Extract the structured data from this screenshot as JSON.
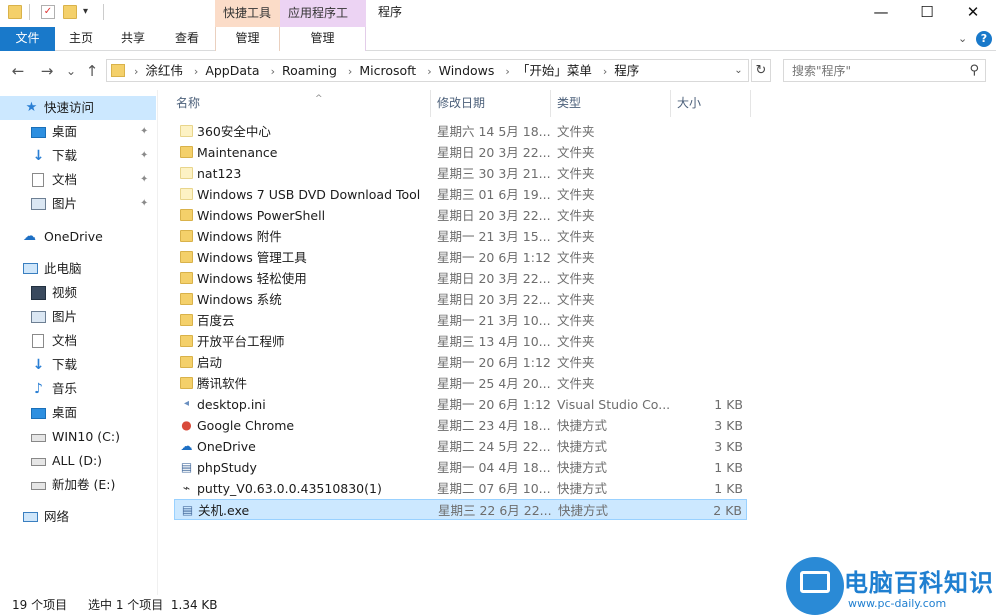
{
  "titlebar": {
    "context_tab_quick": "快捷工具",
    "context_tab_app": "应用程序工具",
    "window_title": "程序",
    "minimize_glyph": "—",
    "maximize_glyph": "☐",
    "close_glyph": "✕"
  },
  "ribbon": {
    "tabs": {
      "file": "文件",
      "home": "主页",
      "share": "共享",
      "view": "查看",
      "manage1": "管理",
      "manage2": "管理"
    }
  },
  "nav": {
    "back_glyph": "←",
    "forward_glyph": "→",
    "recent_glyph": "⌄",
    "up_glyph": "↑",
    "breadcrumbs": [
      "涂红伟",
      "AppData",
      "Roaming",
      "Microsoft",
      "Windows",
      "「开始」菜单",
      "程序"
    ],
    "refresh_glyph": "↻",
    "search_placeholder": "搜索\"程序\""
  },
  "sidebar": {
    "quick_access": "快速访问",
    "quick_items": [
      "桌面",
      "下载",
      "文档",
      "图片"
    ],
    "onedrive": "OneDrive",
    "this_pc": "此电脑",
    "pc_items": [
      "视频",
      "图片",
      "文档",
      "下载",
      "音乐",
      "桌面",
      "WIN10 (C:)",
      "ALL (D:)",
      "新加卷 (E:)"
    ],
    "network": "网络"
  },
  "columns": {
    "name": "名称",
    "date": "修改日期",
    "type": "类型",
    "size": "大小"
  },
  "files": [
    {
      "name": "360安全中心",
      "date": "星期六 14 5月 18...",
      "type": "文件夹",
      "size": "",
      "icon": "folder-pale-icon"
    },
    {
      "name": "Maintenance",
      "date": "星期日 20 3月 22...",
      "type": "文件夹",
      "size": "",
      "icon": "folder-icon"
    },
    {
      "name": "nat123",
      "date": "星期三 30 3月 21...",
      "type": "文件夹",
      "size": "",
      "icon": "folder-pale-icon"
    },
    {
      "name": "Windows 7 USB DVD Download Tool",
      "date": "星期三 01 6月 19...",
      "type": "文件夹",
      "size": "",
      "icon": "folder-pale-icon"
    },
    {
      "name": "Windows PowerShell",
      "date": "星期日 20 3月 22...",
      "type": "文件夹",
      "size": "",
      "icon": "folder-icon"
    },
    {
      "name": "Windows 附件",
      "date": "星期一 21 3月 15...",
      "type": "文件夹",
      "size": "",
      "icon": "folder-icon"
    },
    {
      "name": "Windows 管理工具",
      "date": "星期一 20 6月 1:12",
      "type": "文件夹",
      "size": "",
      "icon": "folder-icon"
    },
    {
      "name": "Windows 轻松使用",
      "date": "星期日 20 3月 22...",
      "type": "文件夹",
      "size": "",
      "icon": "folder-icon"
    },
    {
      "name": "Windows 系统",
      "date": "星期日 20 3月 22...",
      "type": "文件夹",
      "size": "",
      "icon": "folder-icon"
    },
    {
      "name": "百度云",
      "date": "星期一 21 3月 10...",
      "type": "文件夹",
      "size": "",
      "icon": "folder-icon"
    },
    {
      "name": "开放平台工程师",
      "date": "星期三 13 4月 10...",
      "type": "文件夹",
      "size": "",
      "icon": "folder-icon"
    },
    {
      "name": "启动",
      "date": "星期一 20 6月 1:12",
      "type": "文件夹",
      "size": "",
      "icon": "folder-icon"
    },
    {
      "name": "腾讯软件",
      "date": "星期一 25 4月 20...",
      "type": "文件夹",
      "size": "",
      "icon": "folder-icon"
    },
    {
      "name": "desktop.ini",
      "date": "星期一 20 6月 1:12",
      "type": "Visual Studio Co...",
      "size": "1 KB",
      "icon": "ini-file-icon"
    },
    {
      "name": "Google Chrome",
      "date": "星期二 23 4月 18...",
      "type": "快捷方式",
      "size": "3 KB",
      "icon": "chrome-icon"
    },
    {
      "name": "OneDrive",
      "date": "星期二 24 5月 22...",
      "type": "快捷方式",
      "size": "3 KB",
      "icon": "onedrive-icon"
    },
    {
      "name": "phpStudy",
      "date": "星期一 04 4月 18...",
      "type": "快捷方式",
      "size": "1 KB",
      "icon": "shortcut-icon"
    },
    {
      "name": "putty_V0.63.0.0.43510830(1)",
      "date": "星期二 07 6月 10...",
      "type": "快捷方式",
      "size": "1 KB",
      "icon": "putty-icon"
    },
    {
      "name": "关机.exe",
      "date": "星期三 22 6月 22...",
      "type": "快捷方式",
      "size": "2 KB",
      "icon": "shortcut-icon"
    }
  ],
  "status": {
    "count": "19 个项目",
    "selection": "选中 1 个项目  1.34 KB"
  },
  "watermark": {
    "title": "电脑百科知识",
    "url": "www.pc-daily.com"
  }
}
